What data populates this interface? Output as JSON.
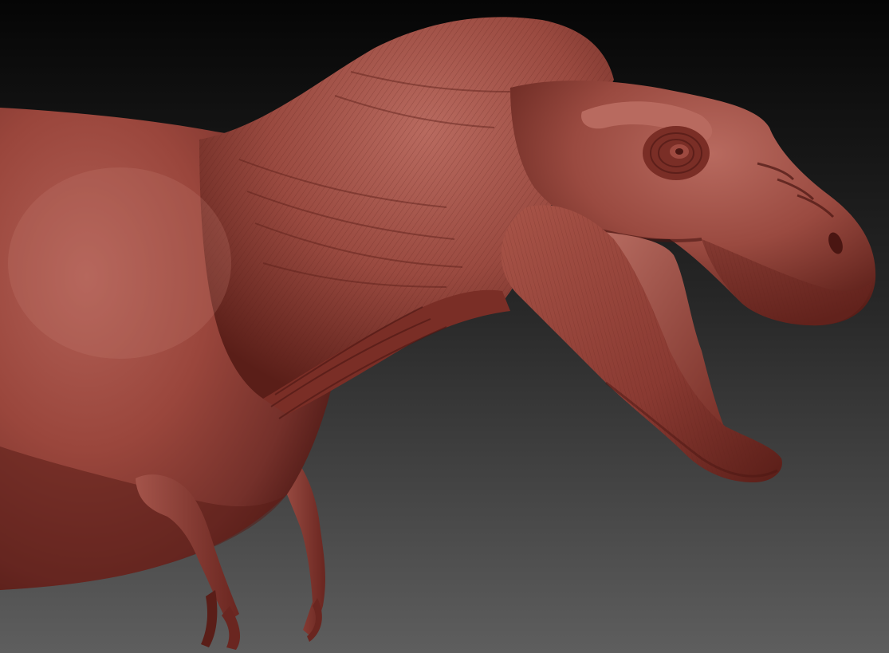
{
  "scene": {
    "subject": "t-rex-sculpt",
    "material_color": "#8a3a32",
    "highlight_color": "#b8655a",
    "shadow_color": "#4a1612",
    "background_top": "#050505",
    "background_bottom": "#5a5a5a",
    "icons": [
      "eye-icon",
      "nostril-icon"
    ]
  }
}
